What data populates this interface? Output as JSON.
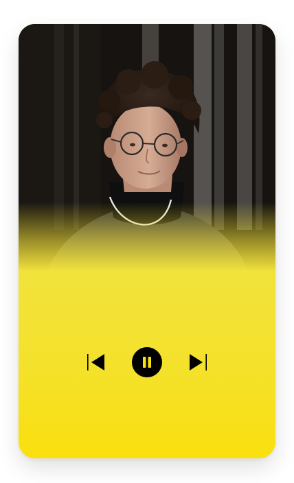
{
  "player": {
    "photo_icon": "portrait-photo",
    "controls": {
      "previous_icon": "skip-previous-icon",
      "pause_icon": "pause-icon",
      "next_icon": "skip-next-icon"
    },
    "colors": {
      "accent": "#f9e012",
      "control": "#000000",
      "backdrop": "#161310"
    }
  }
}
